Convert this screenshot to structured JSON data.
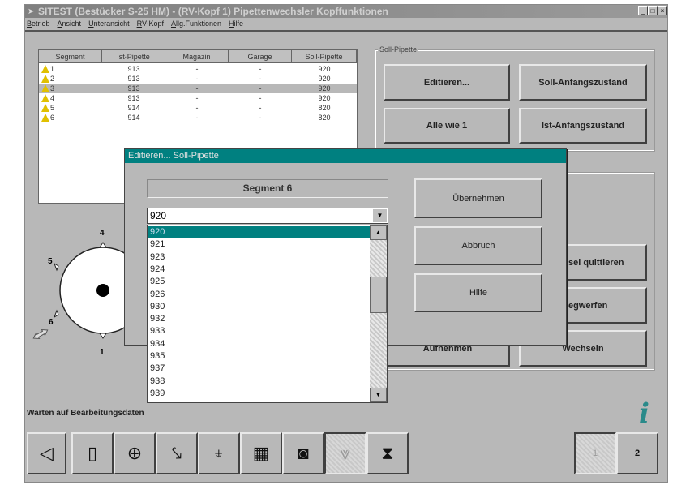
{
  "window": {
    "title": "SITEST (Bestücker S-25 HM) - (RV-Kopf 1) Pipettenwechsler Kopffunktionen",
    "min": "_",
    "max": "□",
    "close": "×"
  },
  "menu": [
    "Betrieb",
    "Ansicht",
    "Unteransicht",
    "RV-Kopf",
    "Allg.Funktionen",
    "Hilfe"
  ],
  "table": {
    "columns": [
      "Segment",
      "Ist-Pipette",
      "Magazin",
      "Garage",
      "Soll-Pipette"
    ],
    "rows": [
      [
        "1",
        "913",
        "-",
        "-",
        "920"
      ],
      [
        "2",
        "913",
        "-",
        "-",
        "920"
      ],
      [
        "3",
        "913",
        "-",
        "-",
        "920"
      ],
      [
        "4",
        "913",
        "-",
        "-",
        "920"
      ],
      [
        "5",
        "914",
        "-",
        "-",
        "820"
      ],
      [
        "6",
        "914",
        "-",
        "-",
        "820"
      ]
    ],
    "selected_row": 2
  },
  "soll_group": {
    "label": "Soll-Pipette",
    "editieren": "Editieren...",
    "soll_anfang": "Soll-Anfangszustand",
    "alle_wie_1": "Alle wie 1",
    "ist_anfang": "Ist-Anfangszustand"
  },
  "lower_group": {
    "quittieren": "sel quittieren",
    "wegwerfen": "egwerfen",
    "aufnehmen": "Aufnehmen",
    "wechseln": "Wechseln"
  },
  "disk": {
    "labels": [
      "4",
      "5",
      "6",
      "1"
    ]
  },
  "dialog": {
    "title": "Editieren... Soll-Pipette",
    "segment": "Segment 6",
    "combo_value": "920",
    "options": [
      "920",
      "921",
      "923",
      "924",
      "925",
      "926",
      "930",
      "932",
      "933",
      "934",
      "935",
      "937",
      "938",
      "939"
    ],
    "selected_option": 0,
    "ok": "Übernehmen",
    "cancel": "Abbruch",
    "help": "Hilfe"
  },
  "status": {
    "text": "Warten auf Bearbeitungsdaten"
  },
  "toolbar": {
    "right_labels": [
      "1",
      "2"
    ]
  },
  "colors": {
    "accent": "#008080",
    "face": "#b8b8b8"
  }
}
